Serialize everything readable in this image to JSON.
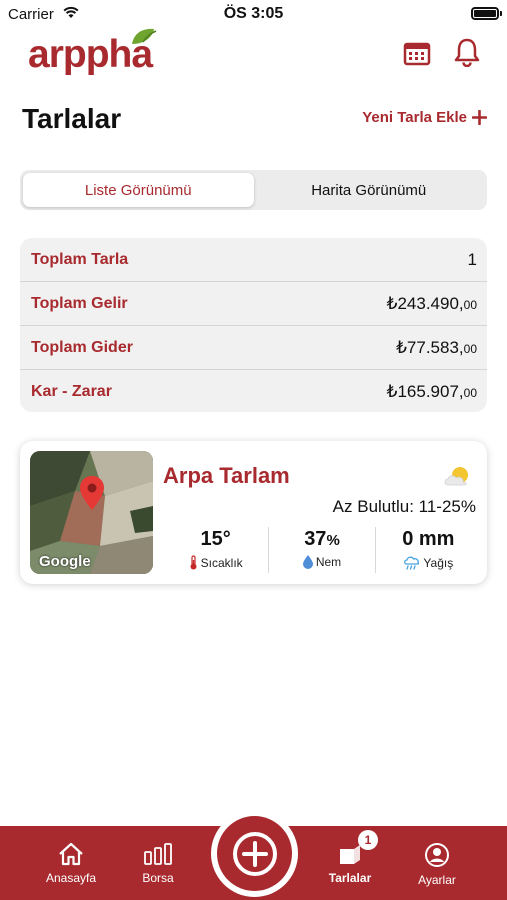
{
  "status_bar": {
    "carrier": "Carrier",
    "time": "ÖS 3:05"
  },
  "header": {
    "logo_text": "arppha"
  },
  "page": {
    "title": "Tarlalar",
    "add_field_label": "Yeni Tarla Ekle"
  },
  "view_toggle": {
    "options": [
      "Liste Görünümü",
      "Harita Görünümü"
    ],
    "selected": "Liste Görünümü"
  },
  "summary": {
    "rows": [
      {
        "label": "Toplam Tarla",
        "value": "1",
        "decimals": ""
      },
      {
        "label": "Toplam Gelir",
        "value": "₺243.490,",
        "decimals": "00"
      },
      {
        "label": "Toplam Gider",
        "value": "₺77.583,",
        "decimals": "00"
      },
      {
        "label": "Kar - Zarar",
        "value": "₺165.907,",
        "decimals": "00"
      }
    ]
  },
  "field_card": {
    "name": "Arpa Tarlam",
    "map_attribution": "Google",
    "weather_icon": "partly-cloudy-icon",
    "weather_description": "Az Bulutlu: 11-25%",
    "stats": [
      {
        "value": "15°",
        "unit": "",
        "label": "Sıcaklık",
        "icon": "thermometer-icon"
      },
      {
        "value": "37",
        "unit": "%",
        "label": "Nem",
        "icon": "drop-icon"
      },
      {
        "value": "0 mm",
        "unit": "",
        "label": "Yağış",
        "icon": "rain-cloud-icon"
      }
    ]
  },
  "tab_bar": {
    "tabs": [
      {
        "label": "Anasayfa",
        "icon": "home-icon"
      },
      {
        "label": "Borsa",
        "icon": "bars-icon"
      },
      {
        "label": "Tarlalar",
        "icon": "field-icon"
      },
      {
        "label": "Ayarlar",
        "icon": "user-icon"
      }
    ],
    "active": "Tarlalar",
    "fields_badge": "1"
  },
  "colors": {
    "brand": "#a82a2e",
    "leaf": "#6fa52f"
  }
}
